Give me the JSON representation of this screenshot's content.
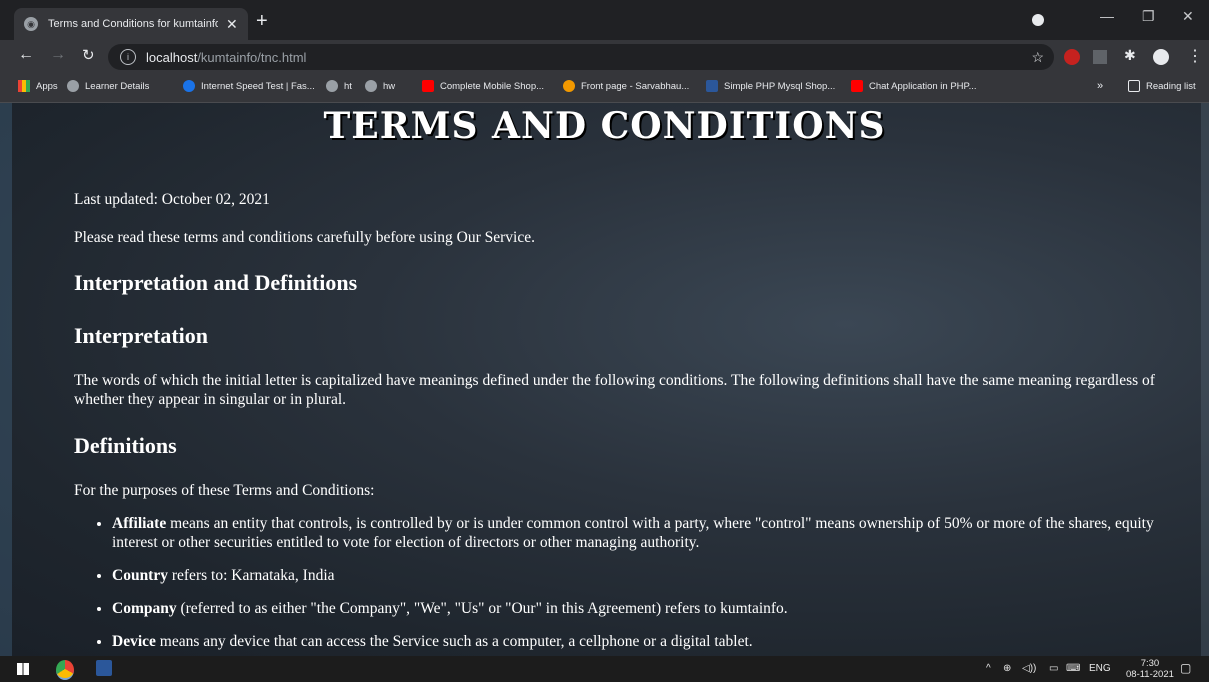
{
  "browser": {
    "tab_title": "Terms and Conditions for kumtainfo",
    "url_host": "localhost",
    "url_path": "/kumtainfo/tnc.html"
  },
  "bookmarks": {
    "apps": "Apps",
    "items": [
      "Learner Details",
      "Internet Speed Test | Fas...",
      "ht",
      "hw",
      "Complete Mobile Shop...",
      "Front page - Sarvabhau...",
      "Simple PHP Mysql Shop...",
      "Chat Application in PHP..."
    ],
    "overflow": "»",
    "reading_list": "Reading list"
  },
  "page": {
    "title": "TERMS AND CONDITIONS",
    "last_updated": "Last updated: October 02, 2021",
    "intro": "Please read these terms and conditions carefully before using Our Service.",
    "h_interp_defs": "Interpretation and Definitions",
    "h_interpretation": "Interpretation",
    "interpretation_text": "The words of which the initial letter is capitalized have meanings defined under the following conditions. The following definitions shall have the same meaning regardless of whether they appear in singular or in plural.",
    "h_definitions": "Definitions",
    "definitions_intro": "For the purposes of these Terms and Conditions:",
    "definitions": [
      {
        "term": "Affiliate",
        "text": " means an entity that controls, is controlled by or is under common control with a party, where \"control\" means ownership of 50% or more of the shares, equity interest or other securities entitled to vote for election of directors or other managing authority."
      },
      {
        "term": "Country",
        "text": " refers to: Karnataka, India"
      },
      {
        "term": "Company",
        "text": " (referred to as either \"the Company\", \"We\", \"Us\" or \"Our\" in this Agreement) refers to kumtainfo."
      },
      {
        "term": "Device",
        "text": " means any device that can access the Service such as a computer, a cellphone or a digital tablet."
      }
    ]
  },
  "taskbar": {
    "lang": "ENG",
    "time": "7:30",
    "date": "08-11-2021"
  },
  "colors": {
    "chrome_dark": "#202124",
    "chrome_toolbar": "#35363a",
    "page_bg": "#2a323c",
    "taskbar": "#1c1c1c"
  }
}
